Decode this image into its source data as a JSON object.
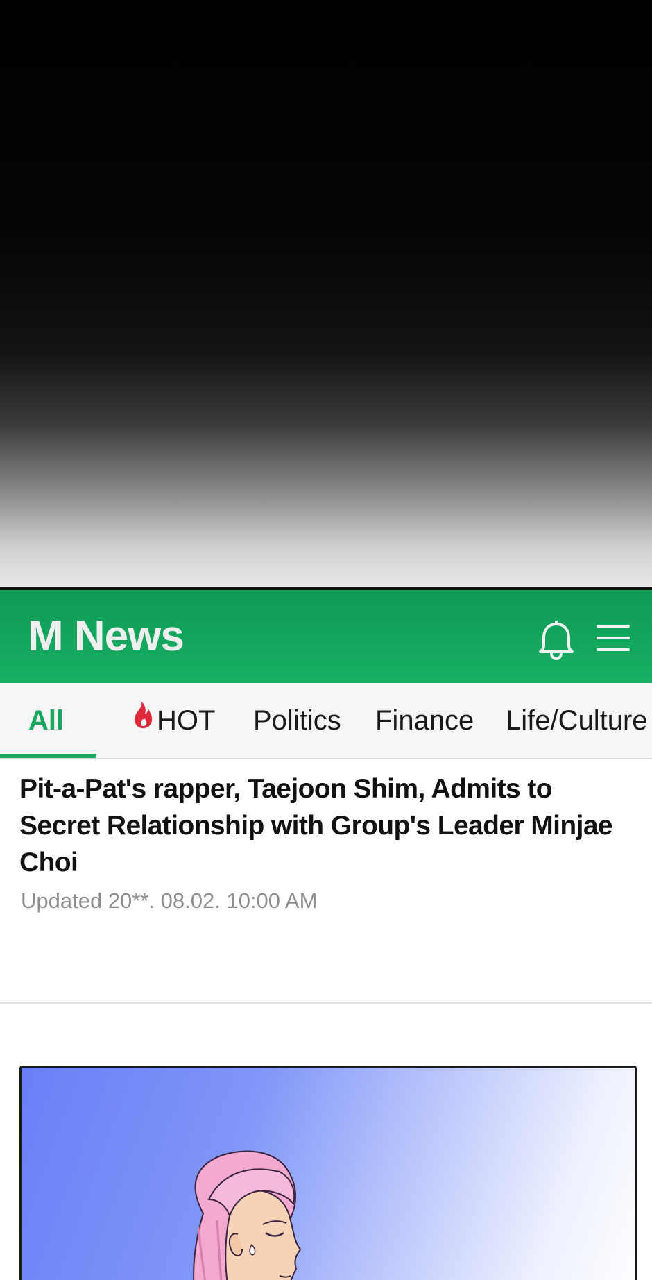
{
  "app": {
    "title": "M News"
  },
  "header_icons": {
    "notifications": "bell-icon",
    "menu": "hamburger-menu-icon"
  },
  "tabs": [
    {
      "label": "All",
      "active": true
    },
    {
      "label": "HOT",
      "icon": "fire-icon",
      "icon_color": "#e0293a"
    },
    {
      "label": "Politics"
    },
    {
      "label": "Finance"
    },
    {
      "label": "Life/Culture"
    }
  ],
  "article": {
    "headline": "Pit-a-Pat's rapper, Taejoon Shim, Admits to Secret Relationship with Group's Leader Minjae Choi",
    "updated": "Updated 20**. 08.02. 10:00 AM"
  },
  "colors": {
    "brand_green": "#13a85c",
    "header_green": "#17b063",
    "hot_red": "#e0293a",
    "muted_text": "#8e8e8e"
  }
}
